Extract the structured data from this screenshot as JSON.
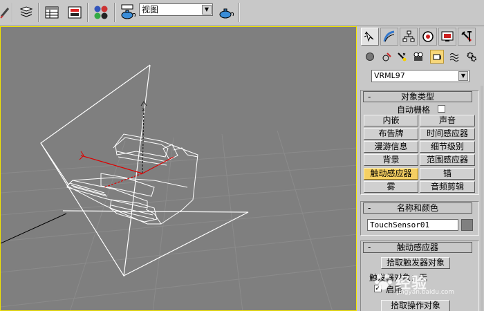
{
  "toolbar": {
    "view_label": "视图"
  },
  "panel": {
    "category": "VRML97",
    "rollouts": {
      "object_type": {
        "title": "对象类型",
        "auto_grid": "自动栅格",
        "buttons": [
          "内嵌",
          "声音",
          "布告牌",
          "时间感应器",
          "漫游信息",
          "细节级别",
          "背景",
          "范围感应器",
          "触动感应器",
          "锚",
          "雾",
          "音频剪辑"
        ],
        "selected": "触动感应器"
      },
      "name_color": {
        "title": "名称和颜色",
        "name_value": "TouchSensor01",
        "color": "#808080"
      },
      "touch_sensor": {
        "title": "触动感应器",
        "pick_trigger": "拾取触发器对象",
        "trigger_object_label": "触发器对象：无",
        "enable_label": "启用",
        "pick_action": "拾取操作对象"
      }
    }
  },
  "watermark": {
    "text": "经验",
    "url": "jingyan.baidu.com"
  },
  "colors": {
    "viewport_bg": "#7f7f7f",
    "viewport_border": "#f2e400",
    "selected_button": "#f5cf62"
  }
}
